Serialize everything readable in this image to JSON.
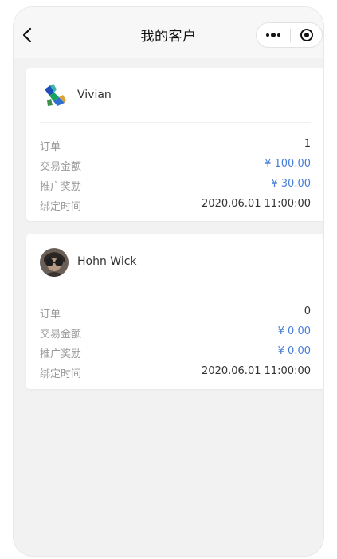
{
  "navbar": {
    "title": "我的客户",
    "back_icon": "chevron-left-icon",
    "more_icon": "more-dots-icon",
    "close_icon": "target-close-icon"
  },
  "customers": [
    {
      "name": "Vivian",
      "avatar_icon": "colorful-figure-avatar",
      "rows": [
        {
          "label": "订单",
          "value": "1"
        },
        {
          "label": "交易金额",
          "value": "¥ 100.00"
        },
        {
          "label": "推广奖励",
          "value": "¥ 30.00"
        },
        {
          "label": "绑定时间",
          "value": "2020.06.01 11:00:00"
        }
      ]
    },
    {
      "name": "Hohn Wick",
      "avatar_icon": "person-photo-avatar",
      "rows": [
        {
          "label": "订单",
          "value": "0"
        },
        {
          "label": "交易金额",
          "value": "¥ 0.00"
        },
        {
          "label": "推广奖励",
          "value": "¥ 0.00"
        },
        {
          "label": "绑定时间",
          "value": "2020.06.01 11:00:00"
        }
      ]
    }
  ],
  "colors": {
    "page_bg": "#f2f2f2",
    "card_bg": "#ffffff",
    "label": "#9a9a9a",
    "value": "#333333",
    "amount_accent": "#4a7fd6"
  }
}
